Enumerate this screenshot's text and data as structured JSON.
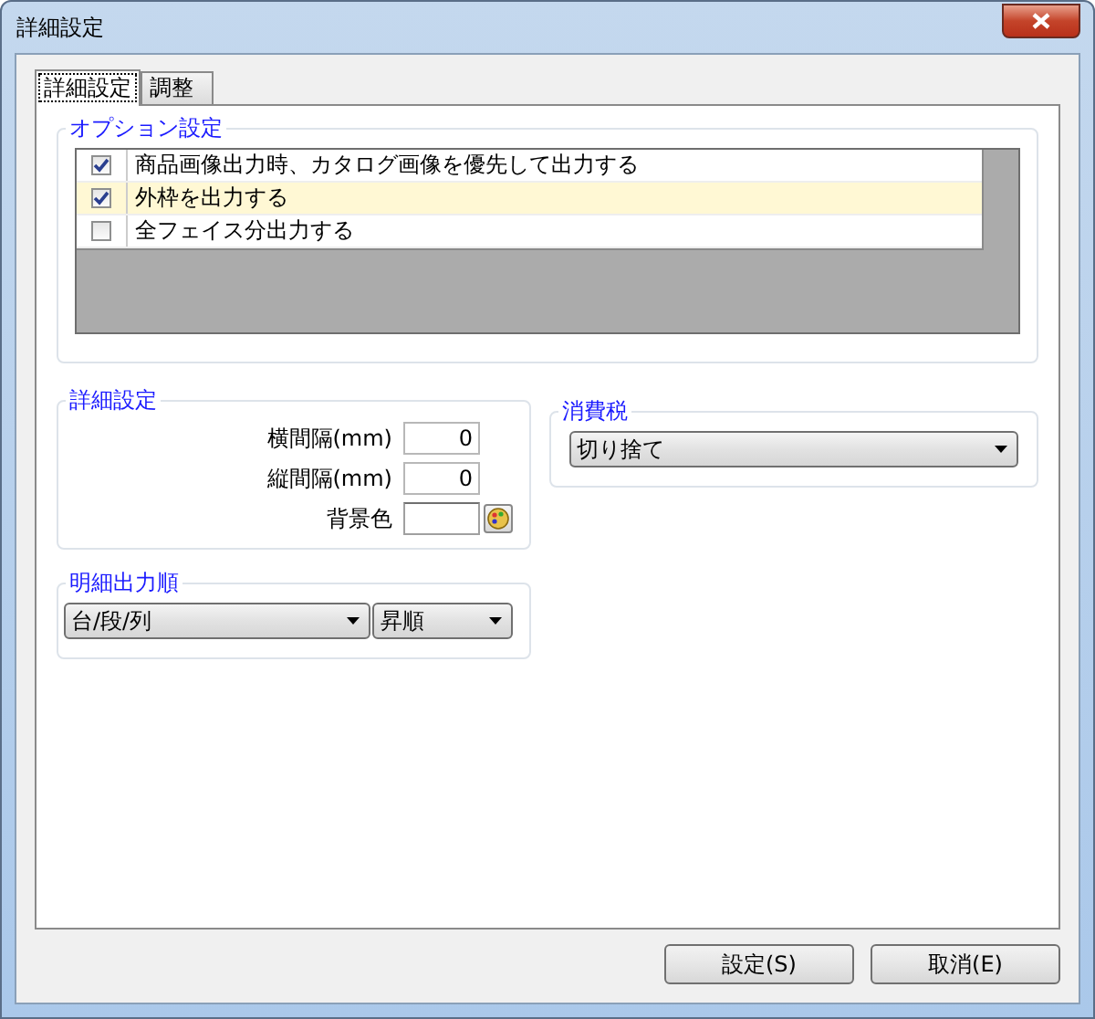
{
  "window": {
    "title": "詳細設定"
  },
  "tabs": [
    {
      "label": "詳細設定",
      "selected": true
    },
    {
      "label": "調整",
      "selected": false
    }
  ],
  "option_group": {
    "title": "オプション設定",
    "items": [
      {
        "label": "商品画像出力時、カタログ画像を優先して出力する",
        "checked": true,
        "selected": false
      },
      {
        "label": "外枠を出力する",
        "checked": true,
        "selected": true
      },
      {
        "label": "全フェイス分出力する",
        "checked": false,
        "selected": false
      }
    ]
  },
  "detail_group": {
    "title": "詳細設定",
    "fields": [
      {
        "kind": "number",
        "label": "横間隔(mm)",
        "value": "0"
      },
      {
        "kind": "number",
        "label": "縦間隔(mm)",
        "value": "0"
      },
      {
        "kind": "color",
        "label": "背景色"
      }
    ]
  },
  "order_group": {
    "title": "明細出力順",
    "dropdowns": [
      {
        "value": "台/段/列",
        "kind": "wide"
      },
      {
        "value": "昇順",
        "kind": "narrow"
      }
    ]
  },
  "tax_group": {
    "title": "消費税",
    "dropdown": {
      "value": "切り捨て"
    }
  },
  "buttons": [
    {
      "label": "設定(S)"
    },
    {
      "label": "取消(E)"
    }
  ]
}
